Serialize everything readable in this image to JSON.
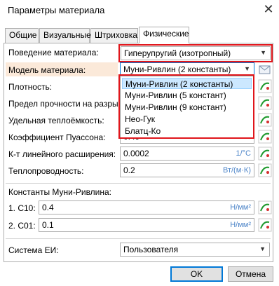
{
  "window": {
    "title": "Параметры материала",
    "close_glyph": "✕"
  },
  "tabs": [
    {
      "label": "Общие"
    },
    {
      "label": "Визуальные"
    },
    {
      "label": "Штриховка"
    },
    {
      "label": "Физические"
    }
  ],
  "behavior": {
    "label": "Поведение материала:",
    "value": "Гиперупругий (изотропный)"
  },
  "model": {
    "label": "Модель материала:",
    "value": "Муни-Ривлин (2 константы)",
    "icon": "book-icon"
  },
  "dropdown": {
    "options": [
      "Муни-Ривлин (2 константы)",
      "Муни-Ривлин (5 констант)",
      "Муни-Ривлин (9 констант)",
      "Нео-Гук",
      "Блатц-Ко"
    ],
    "selected_index": 0
  },
  "fields": {
    "density": {
      "label": "Плотность:"
    },
    "tensile": {
      "label": "Предел прочности на разрыв:"
    },
    "heat": {
      "label": "Удельная теплоёмкость:"
    },
    "poisson": {
      "label": "Коэффициент Пуассона:",
      "value": "0.49"
    },
    "expansion": {
      "label": "К-т линейного расширения:",
      "value": "0.0002",
      "unit": "1/°C"
    },
    "conductivity": {
      "label": "Теплопроводность:",
      "value": "0.2",
      "unit": "Вт/(м·К)"
    }
  },
  "constants": {
    "title": "Константы Муни-Ривлина:",
    "c10": {
      "label": "1. C10:",
      "value": "0.4",
      "unit": "Н/мм²"
    },
    "c01": {
      "label": "2. C01:",
      "value": "0.1",
      "unit": "Н/мм²"
    }
  },
  "units_system": {
    "label": "Система ЕИ:",
    "value": "Пользователя"
  },
  "buttons": {
    "ok": "OK",
    "cancel": "Отмена"
  },
  "colors": {
    "highlight_red": "#e0151b",
    "unit_blue": "#4f86c9",
    "selection": "#cce8ff"
  }
}
